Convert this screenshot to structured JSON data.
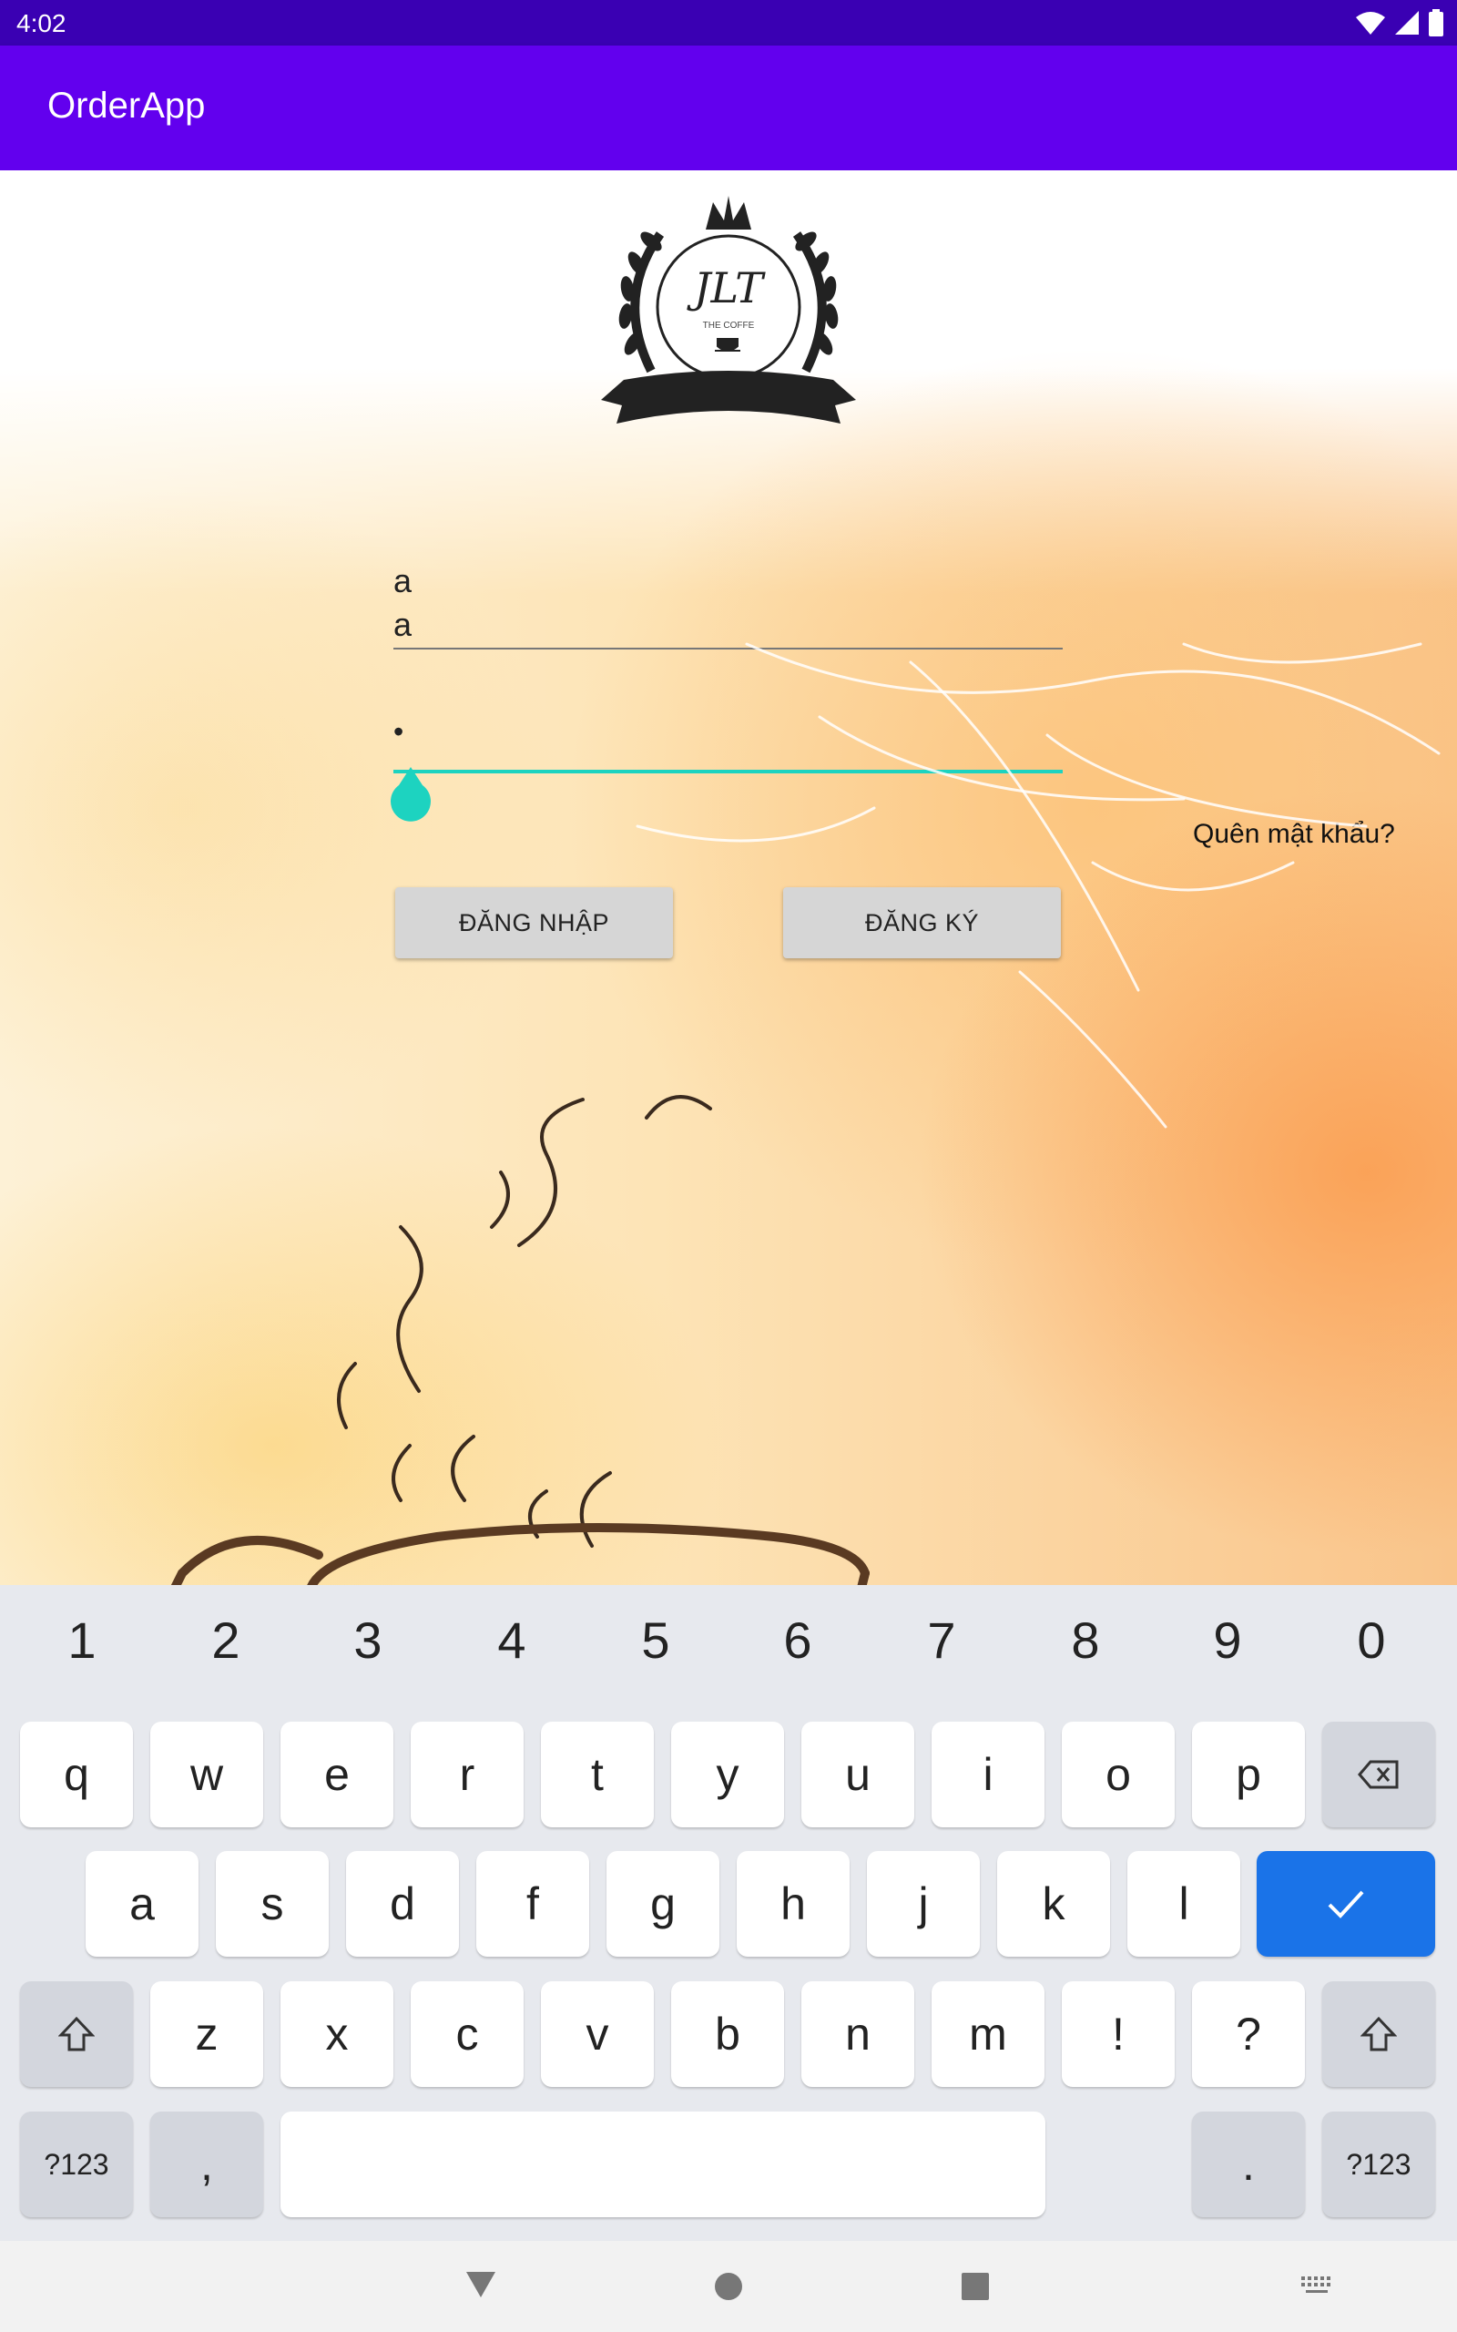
{
  "status_bar": {
    "time": "4:02",
    "icons": [
      "wifi-icon",
      "signal-icon",
      "battery-icon"
    ]
  },
  "app_bar": {
    "title": "OrderApp"
  },
  "logo": {
    "text": "JLT",
    "subtitle": "THE COFFE"
  },
  "login": {
    "username_hint": "a",
    "username_value": "a",
    "password_value": "•",
    "forgot_password": "Quên mật khẩu?",
    "login_button": "ĐĂNG NHẬP",
    "register_button": "ĐĂNG KÝ",
    "accent_color": "#1dd3c0"
  },
  "keyboard": {
    "number_row": [
      "1",
      "2",
      "3",
      "4",
      "5",
      "6",
      "7",
      "8",
      "9",
      "0"
    ],
    "row1": [
      "q",
      "w",
      "e",
      "r",
      "t",
      "y",
      "u",
      "i",
      "o",
      "p"
    ],
    "row2": [
      "a",
      "s",
      "d",
      "f",
      "g",
      "h",
      "j",
      "k",
      "l"
    ],
    "row3": [
      "z",
      "x",
      "c",
      "v",
      "b",
      "n",
      "m",
      "!",
      "?"
    ],
    "symbols_left": "?123",
    "comma": ",",
    "period": ".",
    "symbols_right": "?123",
    "enter_color": "#1a73e8"
  },
  "nav_bar": {
    "icons": [
      "back-icon",
      "home-icon",
      "recents-icon",
      "keyboard-switch-icon"
    ]
  }
}
